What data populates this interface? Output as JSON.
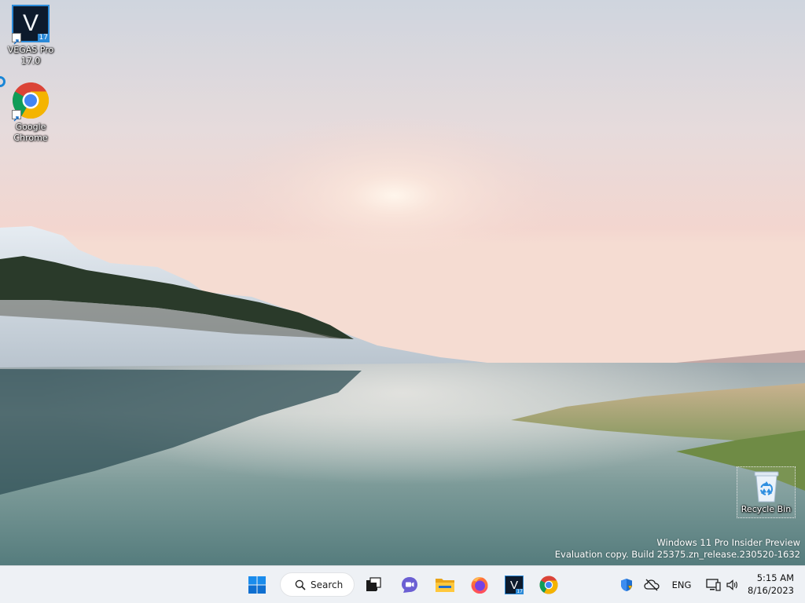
{
  "desktop": {
    "icons": [
      {
        "id": "vegas",
        "label": "VEGAS Pro\n17.0",
        "badge": "17",
        "letter": "V",
        "icon": "vegas-pro-icon"
      },
      {
        "id": "chrome",
        "label": "Google\nChrome",
        "icon": "chrome-icon"
      },
      {
        "id": "recycle",
        "label": "Recycle Bin",
        "icon": "recycle-bin-icon"
      }
    ]
  },
  "watermark": {
    "line1": "Windows 11 Pro Insider Preview",
    "line2": "Evaluation copy. Build 25375.zn_release.230520-1632"
  },
  "taskbar": {
    "search_label": "Search",
    "pinned": [
      "start-icon",
      "task-view-icon",
      "teams-chat-icon",
      "file-explorer-icon",
      "firefox-icon",
      "vegas-pro-icon",
      "chrome-icon"
    ],
    "vegas_badge": "17",
    "vegas_letter": "V"
  },
  "tray": {
    "language": "ENG",
    "time": "5:15 AM",
    "date": "8/16/2023",
    "icons": [
      "security-shield-icon",
      "onedrive-offline-icon",
      "network-icon",
      "volume-icon"
    ]
  },
  "colors": {
    "taskbar_bg": "#eef1f5",
    "accent": "#0078d4"
  }
}
